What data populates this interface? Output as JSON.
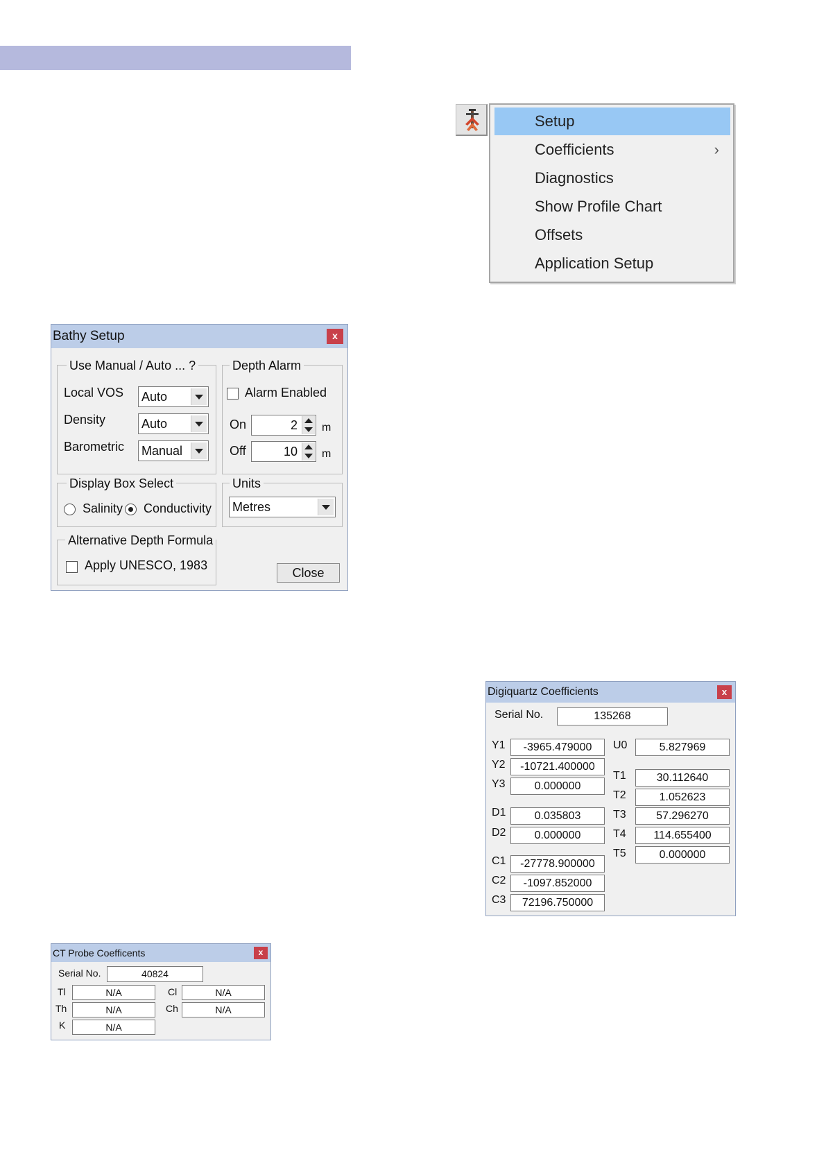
{
  "menu": {
    "items": [
      {
        "label": "Setup"
      },
      {
        "label": "Coefficients",
        "submenu_glyph": "›"
      },
      {
        "label": "Diagnostics"
      },
      {
        "label": "Show Profile Chart"
      },
      {
        "label": "Offsets"
      },
      {
        "label": "Application Setup"
      }
    ],
    "icon": "probe-app-icon",
    "highlight_color": "#98c8f4"
  },
  "bathy_setup": {
    "title": "Bathy Setup",
    "close_glyph": "x",
    "manual_auto": {
      "legend": "Use Manual / Auto ... ?",
      "rows": [
        {
          "label": "Local VOS",
          "value": "Auto"
        },
        {
          "label": "Density",
          "value": "Auto"
        },
        {
          "label": "Barometric",
          "value": "Manual"
        }
      ]
    },
    "depth_alarm": {
      "legend": "Depth Alarm",
      "alarm_enabled_label": "Alarm Enabled",
      "alarm_enabled": false,
      "on_label": "On",
      "on_value": "2",
      "on_unit": "m",
      "off_label": "Off",
      "off_value": "10",
      "off_unit": "m"
    },
    "display_box": {
      "legend": "Display Box Select",
      "salinity_label": "Salinity",
      "conductivity_label": "Conductivity",
      "selected": "Conductivity"
    },
    "units": {
      "legend": "Units",
      "value": "Metres"
    },
    "alt_depth": {
      "legend": "Alternative Depth Formula",
      "apply_label": "Apply UNESCO, 1983",
      "checked": false
    },
    "close_label": "Close"
  },
  "digiquartz": {
    "title": "Digiquartz Coefficients",
    "close_glyph": "x",
    "serial_label": "Serial No.",
    "serial_value": "135268",
    "left": [
      {
        "label": "Y1",
        "value": "-3965.479000"
      },
      {
        "label": "Y2",
        "value": "-10721.400000"
      },
      {
        "label": "Y3",
        "value": "0.000000"
      },
      {
        "label": "D1",
        "value": "0.035803"
      },
      {
        "label": "D2",
        "value": "0.000000"
      },
      {
        "label": "C1",
        "value": "-27778.900000"
      },
      {
        "label": "C2",
        "value": "-1097.852000"
      },
      {
        "label": "C3",
        "value": "72196.750000"
      }
    ],
    "right": [
      {
        "label": "U0",
        "value": "5.827969"
      },
      {
        "label": "T1",
        "value": "30.112640"
      },
      {
        "label": "T2",
        "value": "1.052623"
      },
      {
        "label": "T3",
        "value": "57.296270"
      },
      {
        "label": "T4",
        "value": "114.655400"
      },
      {
        "label": "T5",
        "value": "0.000000"
      }
    ]
  },
  "ct_probe": {
    "title": "CT Probe Coefficents",
    "close_glyph": "x",
    "serial_label": "Serial No.",
    "serial_value": "40824",
    "left": [
      {
        "label": "Tl",
        "value": "N/A"
      },
      {
        "label": "Th",
        "value": "N/A"
      },
      {
        "label": "K",
        "value": "N/A"
      }
    ],
    "right": [
      {
        "label": "Cl",
        "value": "N/A"
      },
      {
        "label": "Ch",
        "value": "N/A"
      }
    ]
  },
  "colors": {
    "banner": "#b5b9dd",
    "titlebar": "#bccde8",
    "close_button": "#c8404a"
  }
}
